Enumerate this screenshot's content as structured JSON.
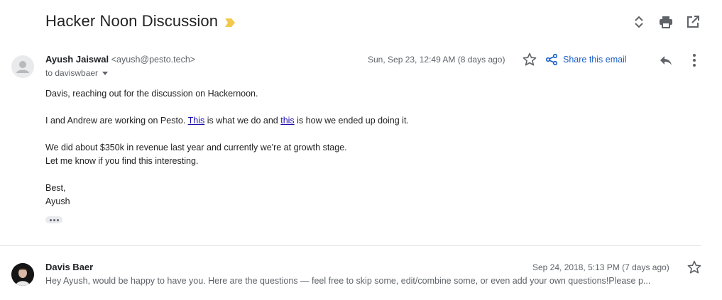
{
  "thread": {
    "subject": "Hacker Noon Discussion",
    "label_color": "#f2c94c",
    "top_icons": [
      "expand-collapse-icon",
      "print-icon",
      "open-in-new-window-icon"
    ]
  },
  "message1": {
    "sender_name": "Ayush Jaiswal",
    "sender_email": "<ayush@pesto.tech>",
    "to_line": "to daviswbaer",
    "date": "Sun, Sep 23, 12:49 AM (8 days ago)",
    "share_label": "Share this email",
    "body": {
      "greeting": "Davis, reaching out for the discussion on Hackernoon.",
      "para2_a": "I and Andrew are working on Pesto. ",
      "link1": "This",
      "para2_b": " is what we do and ",
      "link2": "this",
      "para2_c": " is how we ended up doing it.",
      "para3_line1": "We did about $350k in revenue last year and currently we're at growth stage.",
      "para3_line2": "Let me know if you find this interesting.",
      "signoff": "Best,",
      "signature": "Ayush"
    }
  },
  "message2": {
    "sender_name": "Davis Baer",
    "date": "Sep 24, 2018, 5:13 PM (7 days ago)",
    "snippet": "Hey Ayush, would be happy to have you. Here are the questions — feel free to skip some, edit/combine some, or even add your own questions!Please p..."
  },
  "colors": {
    "link": "#1a0dab",
    "share_link": "#1a5ec7",
    "secondary_text": "#5f6368"
  }
}
